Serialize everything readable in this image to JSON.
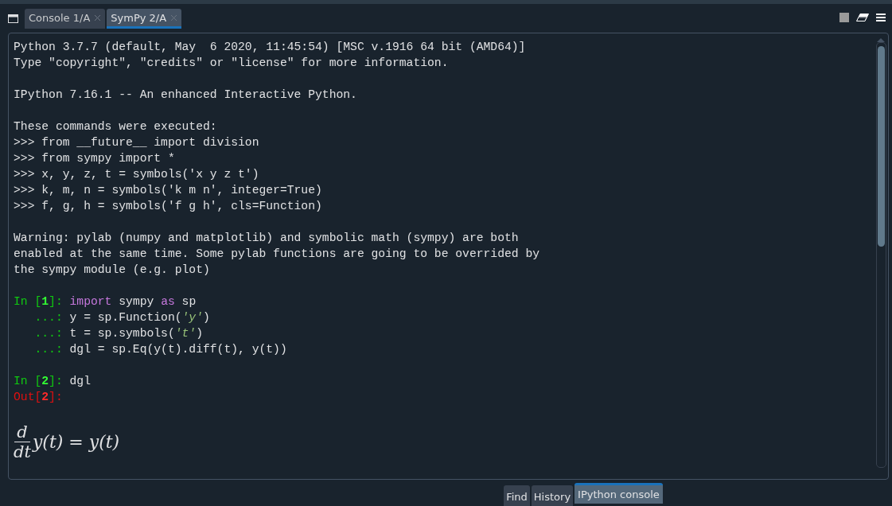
{
  "tabs": [
    {
      "label": "Console 1/A",
      "selected": false
    },
    {
      "label": "SymPy 2/A",
      "selected": true
    }
  ],
  "console": {
    "blocks": [
      {
        "lines": [
          [
            {
              "text": "Python 3.7.7 (default, May  6 2020, 11:45:54) [MSC v.1916 64 bit (AMD64)]",
              "kind": "plain"
            }
          ],
          [
            {
              "text": "Type \"copyright\", \"credits\" or \"license\" for more information.",
              "kind": "plain"
            }
          ]
        ]
      },
      {
        "lines": [
          [
            {
              "text": "IPython 7.16.1 -- An enhanced Interactive Python.",
              "kind": "plain"
            }
          ]
        ]
      },
      {
        "lines": [
          [
            {
              "text": "These commands were executed:",
              "kind": "plain"
            }
          ],
          [
            {
              "text": ">>> from __future__ import division",
              "kind": "plain"
            }
          ],
          [
            {
              "text": ">>> from sympy import *",
              "kind": "plain"
            }
          ],
          [
            {
              "text": ">>> x, y, z, t = symbols('x y z t')",
              "kind": "plain"
            }
          ],
          [
            {
              "text": ">>> k, m, n = symbols('k m n', integer=True)",
              "kind": "plain"
            }
          ],
          [
            {
              "text": ">>> f, g, h = symbols('f g h', cls=Function)",
              "kind": "plain"
            }
          ]
        ]
      },
      {
        "lines": [
          [
            {
              "text": "Warning: pylab (numpy and matplotlib) and symbolic math (sympy) are both",
              "kind": "plain"
            }
          ],
          [
            {
              "text": "enabled at the same time. Some pylab functions are going to be overrided by",
              "kind": "plain"
            }
          ],
          [
            {
              "text": "the sympy module (e.g. plot)",
              "kind": "plain"
            }
          ]
        ]
      },
      {
        "lines": [
          [
            {
              "text": "In [",
              "kind": "in_prompt"
            },
            {
              "text": "1",
              "kind": "in_number"
            },
            {
              "text": "]: ",
              "kind": "in_prompt"
            },
            {
              "text": "import",
              "kind": "keyword"
            },
            {
              "text": " sympy ",
              "kind": "plain"
            },
            {
              "text": "as",
              "kind": "keyword"
            },
            {
              "text": " sp",
              "kind": "plain"
            }
          ],
          [
            {
              "text": "   ...: ",
              "kind": "in_prompt"
            },
            {
              "text": "y = sp.Function(",
              "kind": "plain"
            },
            {
              "text": "'y'",
              "kind": "string"
            },
            {
              "text": ")",
              "kind": "plain"
            }
          ],
          [
            {
              "text": "   ...: ",
              "kind": "in_prompt"
            },
            {
              "text": "t = sp.symbols(",
              "kind": "plain"
            },
            {
              "text": "'t'",
              "kind": "string"
            },
            {
              "text": ")",
              "kind": "plain"
            }
          ],
          [
            {
              "text": "   ...: ",
              "kind": "in_prompt"
            },
            {
              "text": "dgl = sp.Eq(y(t).diff(t), y(t))",
              "kind": "plain"
            }
          ]
        ]
      },
      {
        "lines": [
          [
            {
              "text": "In [",
              "kind": "in_prompt"
            },
            {
              "text": "2",
              "kind": "in_number"
            },
            {
              "text": "]: ",
              "kind": "in_prompt"
            },
            {
              "text": "dgl",
              "kind": "plain"
            }
          ],
          [
            {
              "text": "Out[",
              "kind": "out_prompt"
            },
            {
              "text": "2",
              "kind": "out_number"
            },
            {
              "text": "]:",
              "kind": "out_prompt"
            }
          ]
        ]
      }
    ],
    "math_output": {
      "numerator": "d",
      "denominator": "dt",
      "expression": "y(t) = y(t)"
    }
  },
  "bottom_tabs": [
    {
      "label": "Find",
      "selected": false
    },
    {
      "label": "History",
      "selected": false
    },
    {
      "label": "IPython console",
      "selected": true
    }
  ]
}
